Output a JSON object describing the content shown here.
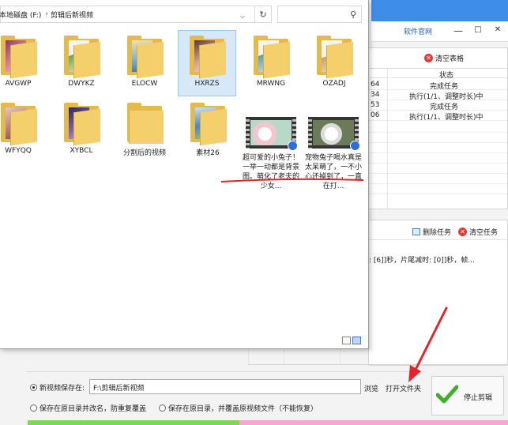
{
  "app": {
    "site_link": "软件官网",
    "window_controls": {
      "minimize": "—",
      "maximize": "□",
      "close": "✕"
    },
    "task_table": {
      "clear_table_label": "清空表格",
      "status_header": "状态",
      "rows": [
        {
          "col1": "64",
          "status": "完成任务"
        },
        {
          "col1": "34",
          "status": "执行(1/1、调整时长)中"
        },
        {
          "col1": "53",
          "status": "完成任务"
        },
        {
          "col1": "06",
          "status": "执行(1/1、调整时长)中"
        }
      ]
    },
    "task_panel": {
      "delete_task_label": "删除任务",
      "clear_task_label": "清空任务",
      "log_line": ": [6]]秒，片尾减时: [0]]秒，帧..."
    },
    "output": {
      "save_label": "新视频保存在:",
      "save_path": "F:\\剪辑后新视频",
      "browse_label": "浏览",
      "open_folder_label": "打开文件夹",
      "option_rename": "保存在原目录并改名，防重复覆盖",
      "option_overwrite": "保存在原目录，并覆盖原视频文件（不能恢复）",
      "stop_label": "停止剪辑"
    },
    "progress_fraction": 0.44
  },
  "explorer": {
    "breadcrumb": {
      "drive": "本地磁盘 (F:)",
      "sep": "›",
      "folder": "剪辑后新视频"
    },
    "search_icon": "search-icon",
    "items": [
      {
        "name": "AVGWP",
        "kind": "folder"
      },
      {
        "name": "DWYKZ",
        "kind": "folder"
      },
      {
        "name": "ELOCW",
        "kind": "folder"
      },
      {
        "name": "HXRZS",
        "kind": "folder",
        "selected": true
      },
      {
        "name": "MRWNG",
        "kind": "folder"
      },
      {
        "name": "OZADJ",
        "kind": "folder"
      },
      {
        "name": "WFYQQ",
        "kind": "folder"
      },
      {
        "name": "XYBCL",
        "kind": "folder"
      },
      {
        "name": "分割后的视频",
        "kind": "folder"
      },
      {
        "name": "素材26",
        "kind": "folder"
      }
    ],
    "videos": [
      {
        "caption": "超可爱的小兔子！一举一动都是背景图。萌化了老夫的少女..."
      },
      {
        "caption": "宠物兔子喝水真是太呆萌了，一不小心还掉到了，一直在打..."
      }
    ]
  }
}
